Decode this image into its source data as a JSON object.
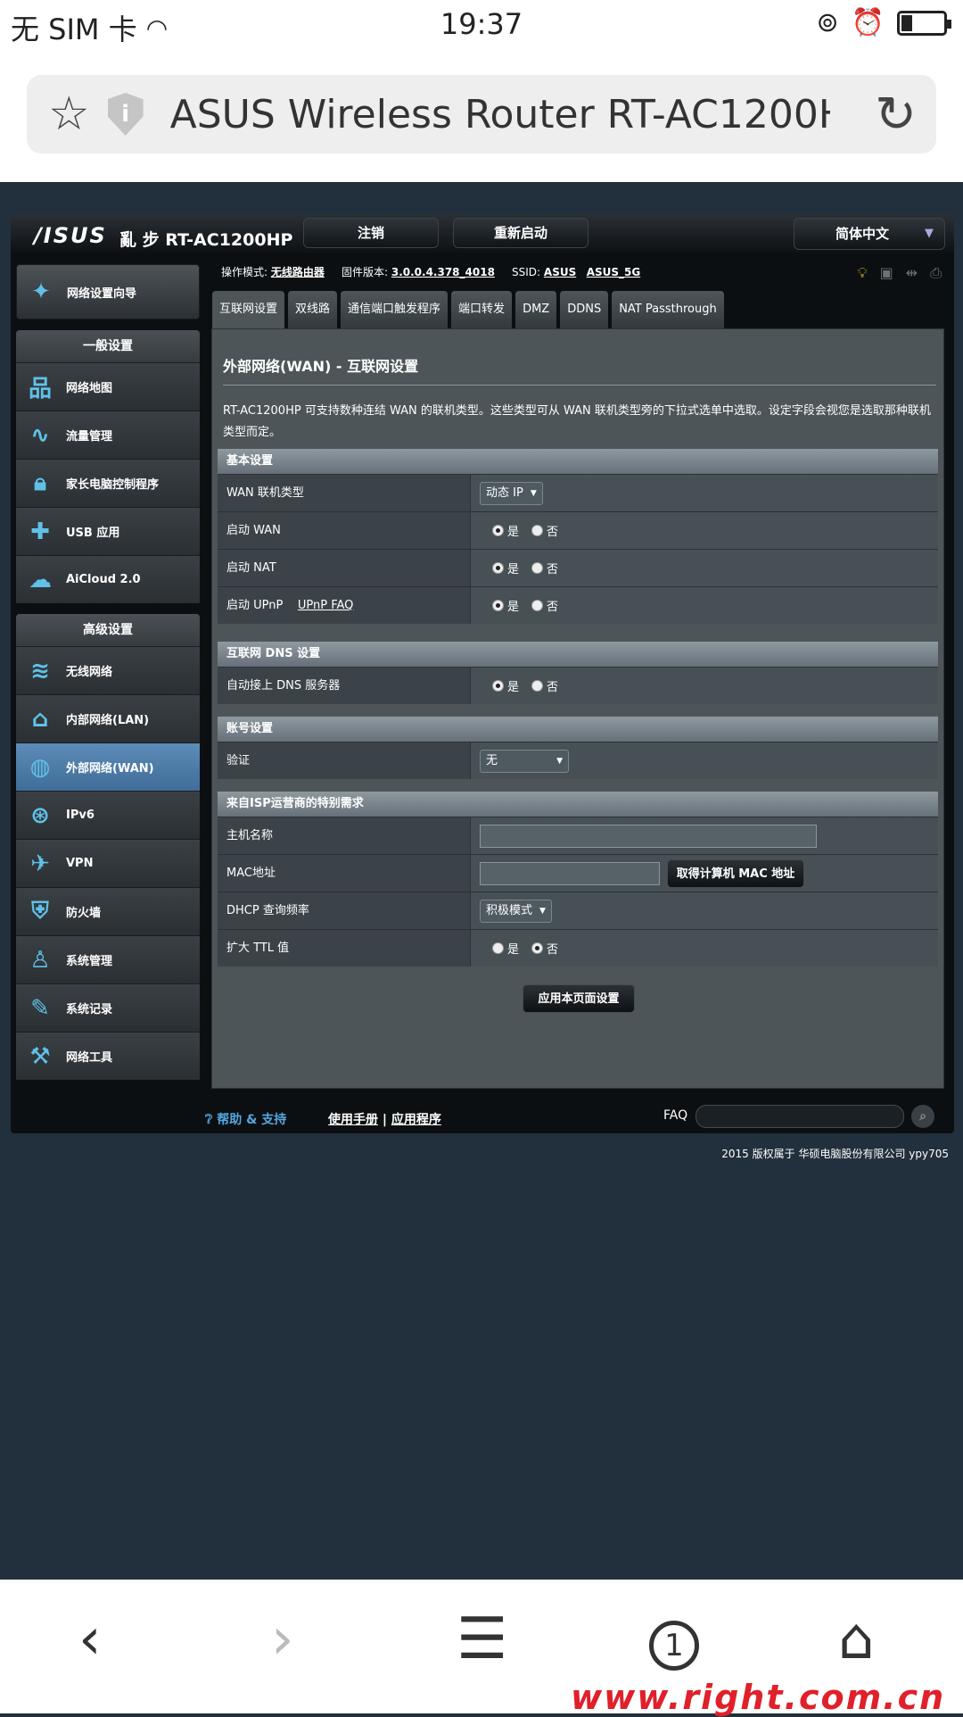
{
  "status_bar": {
    "carrier": "无 SIM 卡",
    "time": "19:37"
  },
  "browser": {
    "page_title": "ASUS Wireless Router RT-AC1200H..."
  },
  "router": {
    "logo": "/ISUS",
    "model": "亂 步 RT-AC1200HP",
    "logout_label": "注销",
    "reboot_label": "重新启动",
    "language": "简体中文",
    "info": {
      "mode_label": "操作模式:",
      "mode_value": "无线路由器",
      "firmware_label": "固件版本:",
      "firmware_value": "3.0.0.4.378_4018",
      "ssid_label": "SSID:",
      "ssid_1": "ASUS",
      "ssid_2": "ASUS_5G"
    },
    "sidebar": {
      "qis": "网络设置向导",
      "general_title": "一般设置",
      "general_items": [
        "网络地图",
        "流量管理",
        "家长电脑控制程序",
        "USB 应用",
        "AiCloud 2.0"
      ],
      "advanced_title": "高级设置",
      "advanced_items": [
        "无线网络",
        "内部网络(LAN)",
        "外部网络(WAN)",
        "IPv6",
        "VPN",
        "防火墙",
        "系统管理",
        "系统记录",
        "网络工具"
      ]
    },
    "tabs": [
      "互联网设置",
      "双线路",
      "通信端口触发程序",
      "端口转发",
      "DMZ",
      "DDNS",
      "NAT Passthrough"
    ],
    "panel": {
      "title": "外部网络(WAN) - 互联网设置",
      "description": "RT-AC1200HP 可支持数种连结 WAN 的联机类型。这些类型可从 WAN 联机类型旁的下拉式选单中选取。设定字段会视您是选取那种联机类型而定。",
      "yes": "是",
      "no": "否",
      "basic": {
        "header": "基本设置",
        "wan_type_label": "WAN 联机类型",
        "wan_type_value": "动态 IP",
        "enable_wan_label": "启动 WAN",
        "enable_nat_label": "启动 NAT",
        "enable_upnp_label": "启动 UPnP",
        "upnp_faq": "UPnP FAQ"
      },
      "dns": {
        "header": "互联网 DNS 设置",
        "auto_dns_label": "自动接上 DNS 服务器"
      },
      "account": {
        "header": "账号设置",
        "auth_label": "验证",
        "auth_value": "无"
      },
      "isp": {
        "header": "来自ISP运营商的特别需求",
        "hostname_label": "主机名称",
        "mac_label": "MAC地址",
        "mac_button": "取得计算机 MAC 地址",
        "dhcp_label": "DHCP 查询频率",
        "dhcp_value": "积极模式",
        "ttl_label": "扩大 TTL 值"
      },
      "apply_button": "应用本页面设置"
    },
    "footer": {
      "help": "帮助 & 支持",
      "manual": "使用手册",
      "utility": "应用程序",
      "faq": "FAQ"
    }
  },
  "copyright": "2015 版权属于 华硕电脑股份有限公司 ypy705",
  "bottom_nav": {
    "tab_count": "1",
    "watermark": "www.right.com.cn"
  }
}
